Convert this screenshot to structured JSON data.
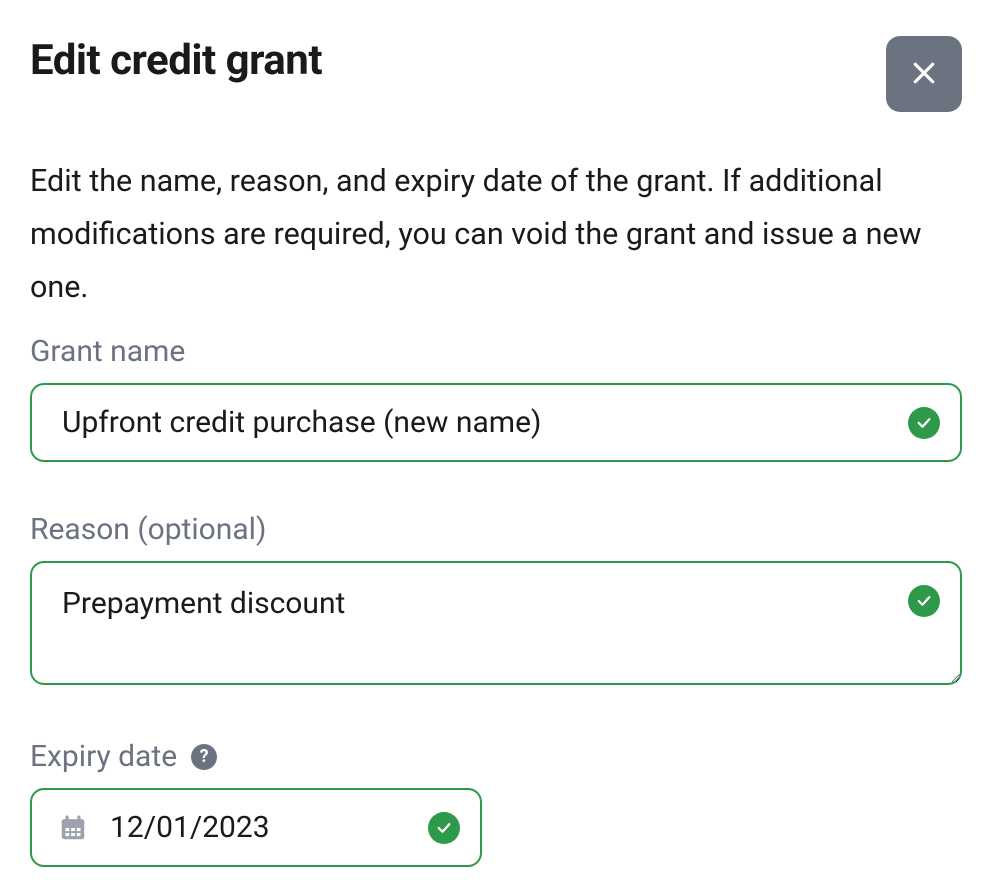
{
  "dialog": {
    "title": "Edit credit grant",
    "description": "Edit the name, reason, and expiry date of the grant. If additional modifications are required, you can void the grant and issue a new one."
  },
  "fields": {
    "grant_name": {
      "label": "Grant name",
      "value": "Upfront credit purchase (new name)",
      "valid": true
    },
    "reason": {
      "label": "Reason (optional)",
      "value": "Prepayment discount",
      "valid": true
    },
    "expiry": {
      "label": "Expiry date",
      "value": "12/01/2023",
      "valid": true
    }
  },
  "icons": {
    "close": "close-icon",
    "help": "help-icon",
    "calendar": "calendar-icon",
    "check": "checkmark-icon"
  },
  "colors": {
    "valid_border": "#2e994a",
    "label_muted": "#6b7280",
    "close_bg": "#6b7280"
  }
}
